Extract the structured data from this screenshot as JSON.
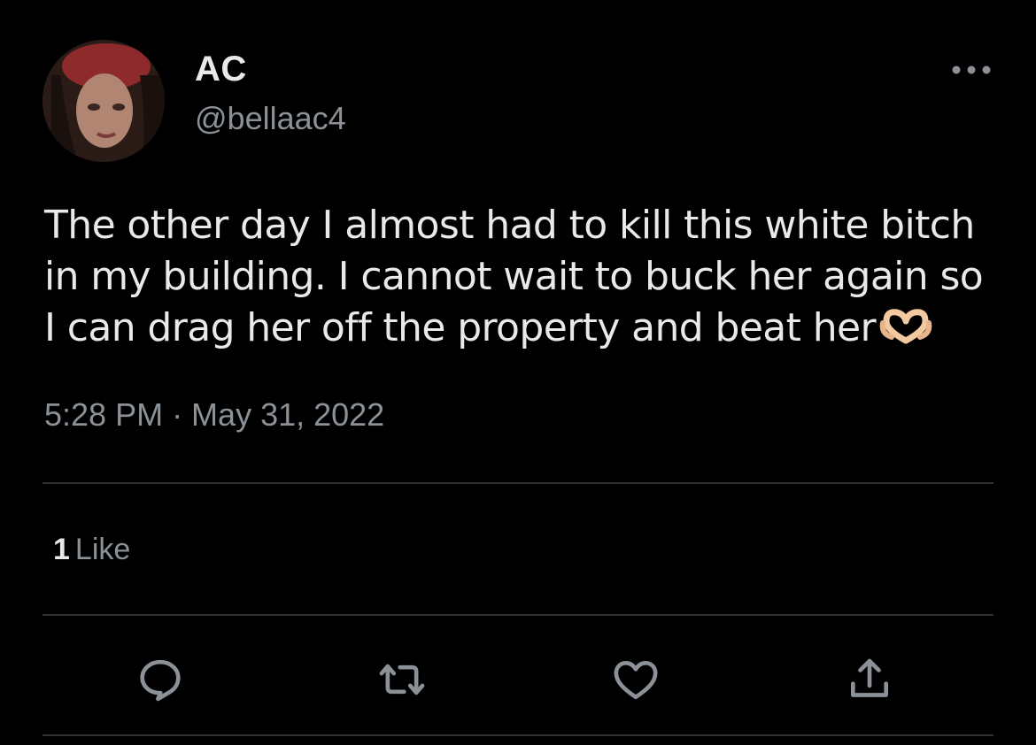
{
  "tweet": {
    "display_name": "AC",
    "handle": "@bellaac4",
    "text": "The other day I almost had to kill this white bitch in my building. I cannot wait to buck her again so I can drag her off the property and beat her",
    "emoji": "heart-hands-emoji",
    "timestamp": "5:28 PM · May 31, 2022",
    "like_count": "1",
    "like_label": "Like"
  },
  "icons": {
    "more": "more-horizontal-icon",
    "reply": "reply-icon",
    "retweet": "retweet-icon",
    "like": "heart-icon",
    "share": "share-icon"
  },
  "colors": {
    "background": "#000000",
    "primary_text": "#e7e9ea",
    "secondary_text": "#8b9196",
    "divider": "#2f3336"
  }
}
